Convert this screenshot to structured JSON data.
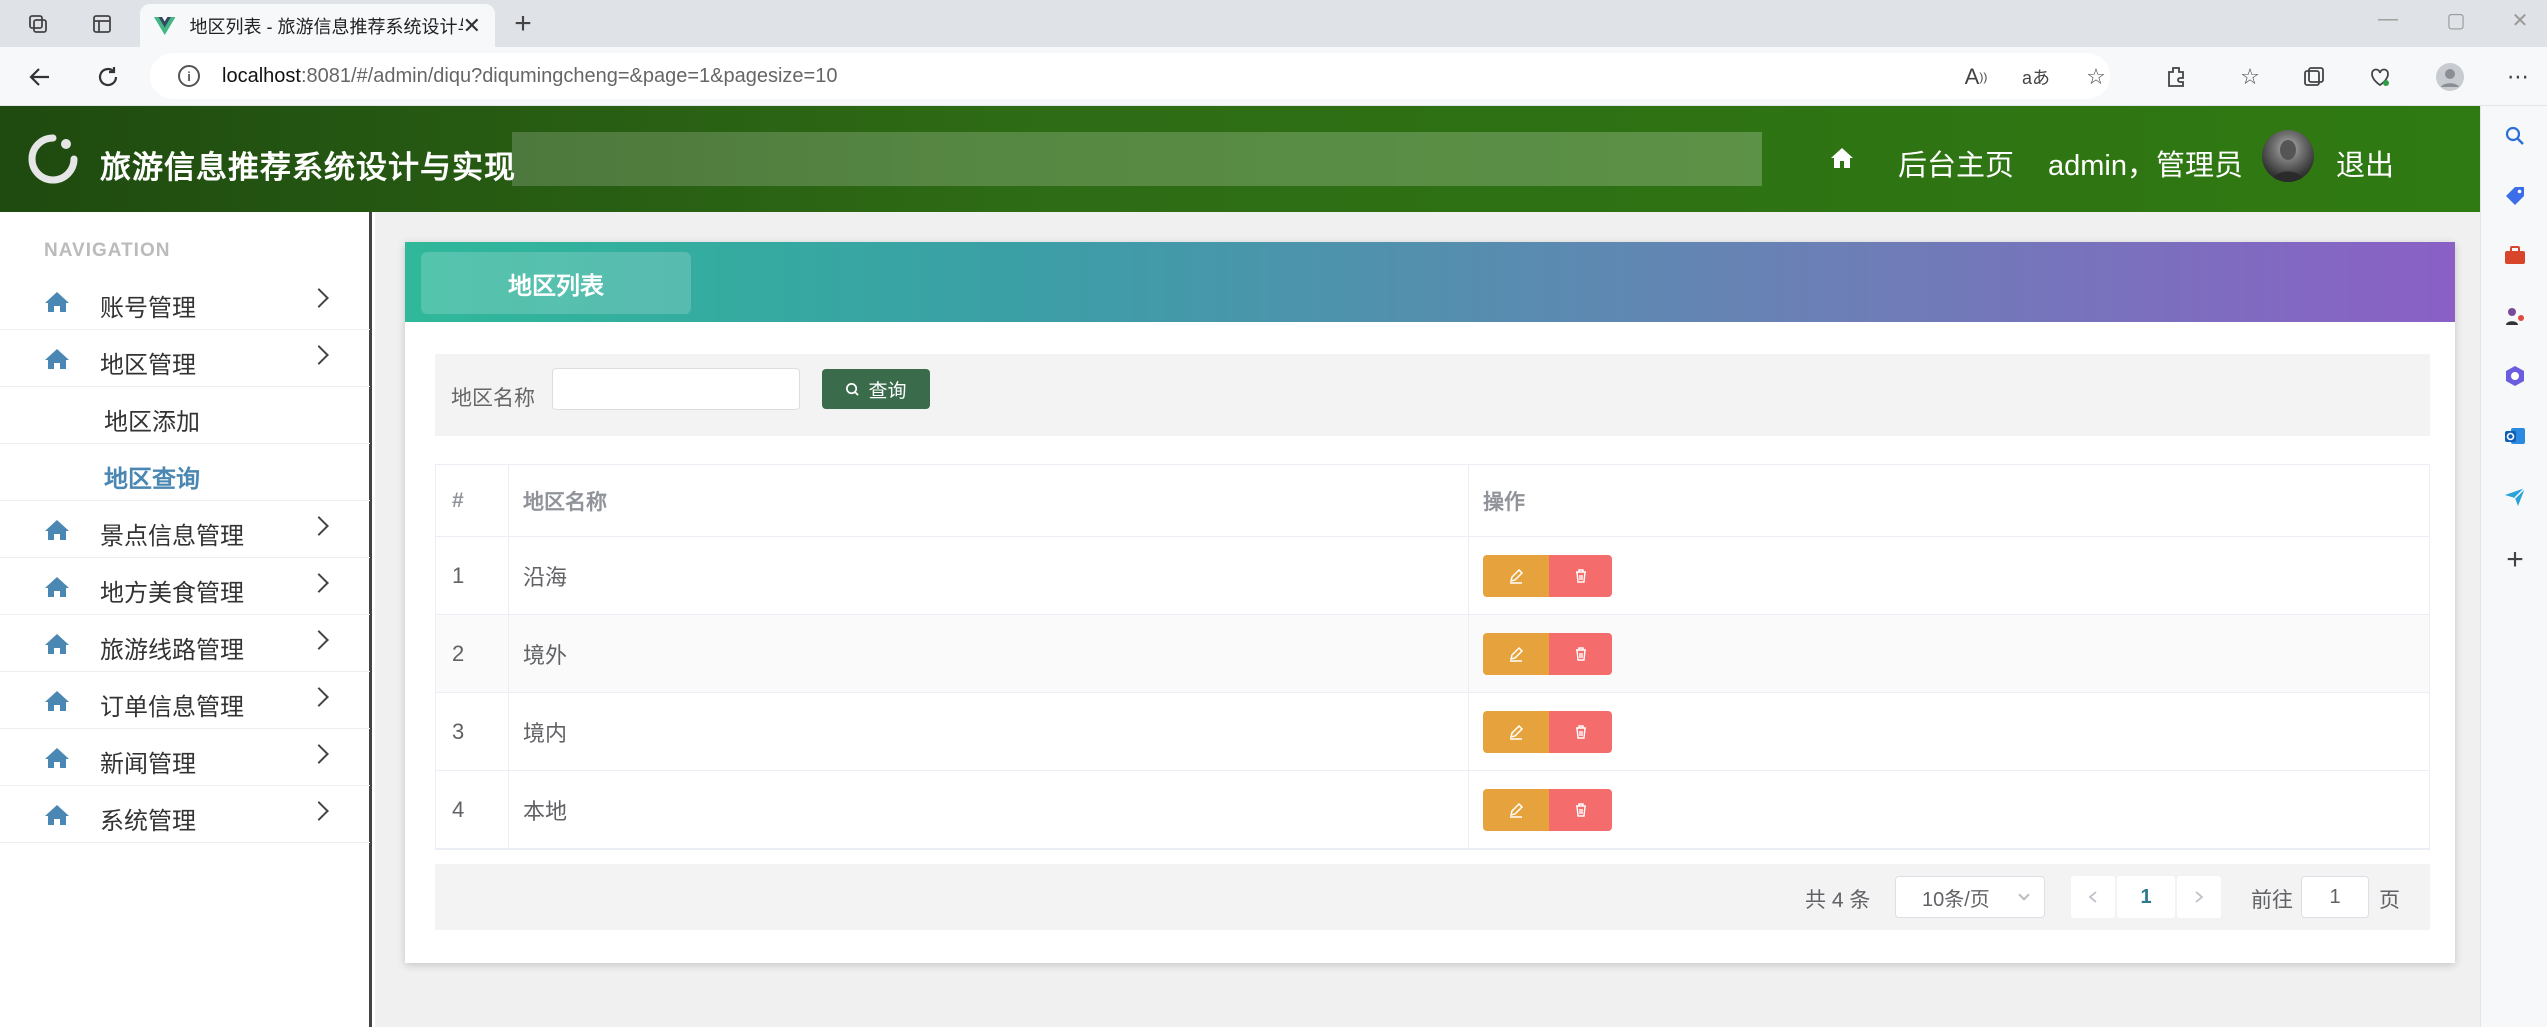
{
  "browser": {
    "tab_title": "地区列表 - 旅游信息推荐系统设计与实现",
    "url_host": "localhost",
    "url_rest": ":8081/#/admin/diqu?diqumingcheng=&page=1&pagesize=10"
  },
  "header": {
    "title": "旅游信息推荐系统设计与实现",
    "home_label": "后台主页",
    "user_label": "admin，管理员",
    "logout_label": "退出"
  },
  "sidebar": {
    "caption": "NAVIGATION",
    "items": [
      {
        "label": "账号管理"
      },
      {
        "label": "地区管理"
      },
      {
        "label": "景点信息管理"
      },
      {
        "label": "地方美食管理"
      },
      {
        "label": "旅游线路管理"
      },
      {
        "label": "订单信息管理"
      },
      {
        "label": "新闻管理"
      },
      {
        "label": "系统管理"
      }
    ],
    "sub_items": [
      {
        "label": "地区添加"
      },
      {
        "label": "地区查询"
      }
    ]
  },
  "page": {
    "card_title": "地区列表",
    "search_label": "地区名称",
    "search_value": "",
    "search_button": "查询"
  },
  "table": {
    "headers": [
      "#",
      "地区名称",
      "操作"
    ],
    "rows": [
      {
        "index": "1",
        "name": "沿海"
      },
      {
        "index": "2",
        "name": "境外"
      },
      {
        "index": "3",
        "name": "境内"
      },
      {
        "index": "4",
        "name": "本地"
      }
    ]
  },
  "pagination": {
    "total": "共 4 条",
    "page_size": "10条/页",
    "current_page": "1",
    "goto_label": "前往",
    "goto_value": "1",
    "page_suffix": "页"
  },
  "colors": {
    "header_green": "#2e6b15",
    "search_button": "#3a6b4b",
    "edit_button": "#e6a23c",
    "delete_button": "#f56c6c",
    "active_menu": "#4a87b3"
  }
}
